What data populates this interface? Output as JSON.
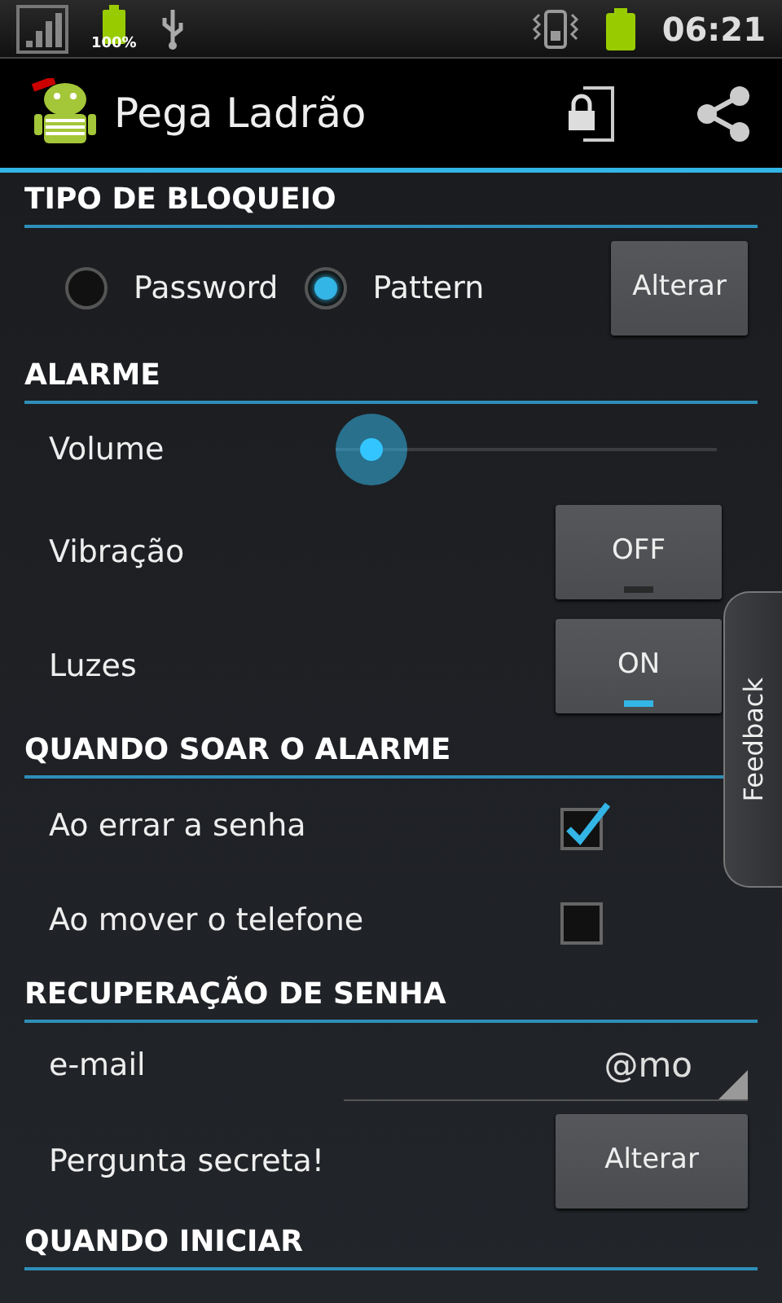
{
  "status_bar": {
    "battery_label": "100%",
    "time": "06:21"
  },
  "action_bar": {
    "title": "Pega Ladrão"
  },
  "sections": [
    {
      "title": "TIPO DE BLOQUEIO",
      "rows": [
        {
          "kind": "radio",
          "options": [
            {
              "label": "Password",
              "selected": false
            },
            {
              "label": "Pattern",
              "selected": true
            }
          ],
          "button": "Alterar"
        }
      ]
    },
    {
      "title": "ALARME",
      "rows": [
        {
          "kind": "slider",
          "label": "Volume"
        },
        {
          "kind": "toggle",
          "label": "Vibração",
          "text": "OFF",
          "on": false
        },
        {
          "kind": "toggle",
          "label": "Luzes",
          "text": "ON",
          "on": true
        }
      ]
    },
    {
      "title": "QUANDO SOAR O ALARME",
      "rows": [
        {
          "kind": "checkbox",
          "label": "Ao errar a senha",
          "checked": true
        },
        {
          "kind": "checkbox",
          "label": "Ao mover o telefone",
          "checked": false
        }
      ]
    },
    {
      "title": "RECUPERAÇÃO DE SENHA",
      "rows": [
        {
          "kind": "field",
          "label": "e-mail",
          "value": "@mo"
        },
        {
          "kind": "button",
          "label": "Pergunta secreta!",
          "button": "Alterar"
        }
      ]
    },
    {
      "title": "QUANDO INICIAR"
    }
  ],
  "feedback_tab": {
    "label": "Feedback"
  }
}
